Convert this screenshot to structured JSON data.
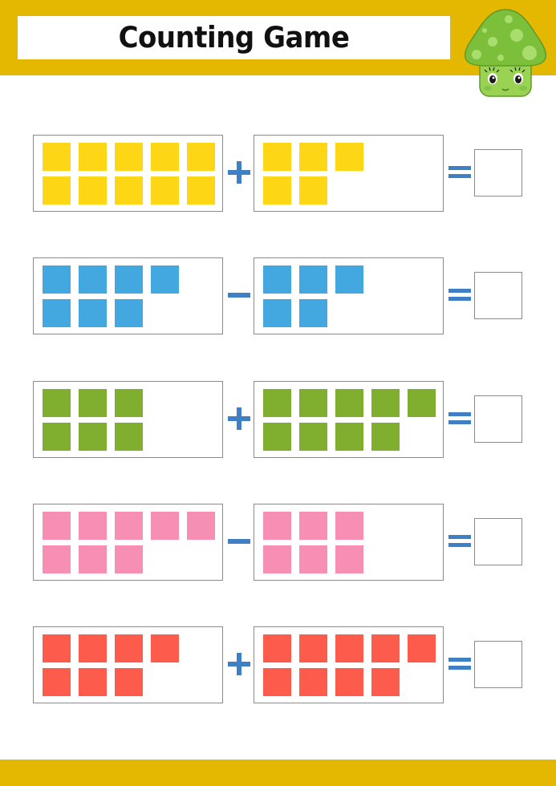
{
  "header": {
    "title": "Counting Game",
    "band_color": "#e4b800",
    "mascot_icon": "mushroom-character-icon"
  },
  "colors": {
    "operator": "#3f7fc4",
    "box_border": "#8a8a8a"
  },
  "problems": [
    {
      "color_name": "yellow",
      "color": "#fdd715",
      "left_count": 10,
      "operator": "+",
      "operator_name": "plus",
      "right_count": 5,
      "answer": ""
    },
    {
      "color_name": "blue",
      "color": "#44a8e0",
      "left_count": 7,
      "operator": "-",
      "operator_name": "minus",
      "right_count": 5,
      "answer": ""
    },
    {
      "color_name": "green",
      "color": "#80ae2f",
      "left_count": 6,
      "operator": "+",
      "operator_name": "plus",
      "right_count": 9,
      "answer": ""
    },
    {
      "color_name": "pink",
      "color": "#f68fb3",
      "left_count": 8,
      "operator": "-",
      "operator_name": "minus",
      "right_count": 6,
      "answer": ""
    },
    {
      "color_name": "red",
      "color": "#fd5c4c",
      "left_count": 7,
      "operator": "+",
      "operator_name": "plus",
      "right_count": 9,
      "answer": ""
    }
  ]
}
